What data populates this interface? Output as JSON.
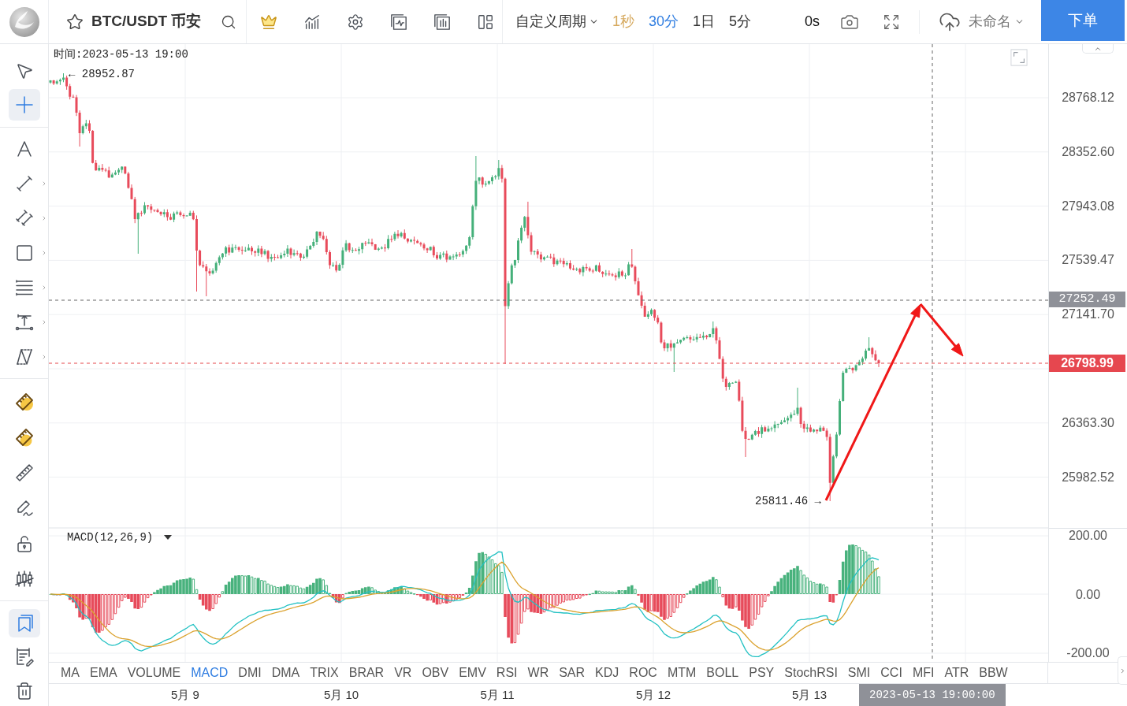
{
  "header": {
    "symbol": "BTC/USDT 币安",
    "favorite": false,
    "custom_period": "自定义周期",
    "periods": [
      {
        "label": "1秒",
        "premium": true,
        "selected": false
      },
      {
        "label": "30分",
        "premium": false,
        "selected": true
      },
      {
        "label": "1日",
        "premium": false,
        "selected": false
      },
      {
        "label": "5分",
        "premium": false,
        "selected": false
      }
    ],
    "countdown": "0s",
    "layout_name": "未命名",
    "order_button": "下单"
  },
  "drawing_toolbar": [
    {
      "tools": [
        {
          "selected": false,
          "has_submenu": false
        },
        {
          "selected": true,
          "has_submenu": false
        }
      ]
    },
    {
      "tools": [
        {
          "selected": false,
          "has_submenu": false
        },
        {
          "selected": false,
          "has_submenu": true
        },
        {
          "selected": false,
          "has_submenu": true
        },
        {
          "selected": false,
          "has_submenu": true
        },
        {
          "selected": false,
          "has_submenu": true
        },
        {
          "selected": false,
          "has_submenu": true
        },
        {
          "selected": false,
          "has_submenu": true
        }
      ]
    },
    {
      "tools": [
        {
          "selected": false,
          "has_submenu": false
        },
        {
          "selected": false,
          "has_submenu": false
        },
        {
          "selected": false,
          "has_submenu": false
        },
        {
          "selected": false,
          "has_submenu": false
        },
        {
          "selected": false,
          "has_submenu": false
        },
        {
          "selected": false,
          "has_submenu": false
        }
      ]
    },
    {
      "tools": [
        {
          "selected": true,
          "has_submenu": false
        },
        {
          "selected": false,
          "has_submenu": false
        },
        {
          "selected": false,
          "has_submenu": false
        }
      ]
    }
  ],
  "chart": {
    "crosshair_time": "时间:2023-05-13 19:00",
    "high_label": "← 28952.87",
    "low_label": "25811.46 →",
    "price_axis": [
      "28768.12",
      "28352.60",
      "27943.08",
      "27539.47",
      "27141.70",
      "26363.30",
      "25982.52"
    ],
    "crosshair_price": "27252.49",
    "last_price": "26798.99"
  },
  "macd_pane": {
    "label": "MACD(12,26,9)",
    "axis": [
      "200.00",
      "0.00",
      "-200.00"
    ]
  },
  "indicator_tabs": [
    {
      "label": "MA",
      "selected": false
    },
    {
      "label": "EMA",
      "selected": false
    },
    {
      "label": "VOLUME",
      "selected": false
    },
    {
      "label": "MACD",
      "selected": true
    },
    {
      "label": "DMI",
      "selected": false
    },
    {
      "label": "DMA",
      "selected": false
    },
    {
      "label": "TRIX",
      "selected": false
    },
    {
      "label": "BRAR",
      "selected": false
    },
    {
      "label": "VR",
      "selected": false
    },
    {
      "label": "OBV",
      "selected": false
    },
    {
      "label": "EMV",
      "selected": false
    },
    {
      "label": "RSI",
      "selected": false
    },
    {
      "label": "WR",
      "selected": false
    },
    {
      "label": "SAR",
      "selected": false
    },
    {
      "label": "KDJ",
      "selected": false
    },
    {
      "label": "ROC",
      "selected": false
    },
    {
      "label": "MTM",
      "selected": false
    },
    {
      "label": "BOLL",
      "selected": false
    },
    {
      "label": "PSY",
      "selected": false
    },
    {
      "label": "StochRSI",
      "selected": false
    },
    {
      "label": "SMI",
      "selected": false
    },
    {
      "label": "CCI",
      "selected": false
    },
    {
      "label": "MFI",
      "selected": false
    },
    {
      "label": "ATR",
      "selected": false
    },
    {
      "label": "BBW",
      "selected": false
    }
  ],
  "time_axis": {
    "labels": [
      "5月 9",
      "5月 10",
      "5月 11",
      "5月 12",
      "5月 13"
    ],
    "crosshair_time": "2023-05-13 19:00:00"
  }
}
